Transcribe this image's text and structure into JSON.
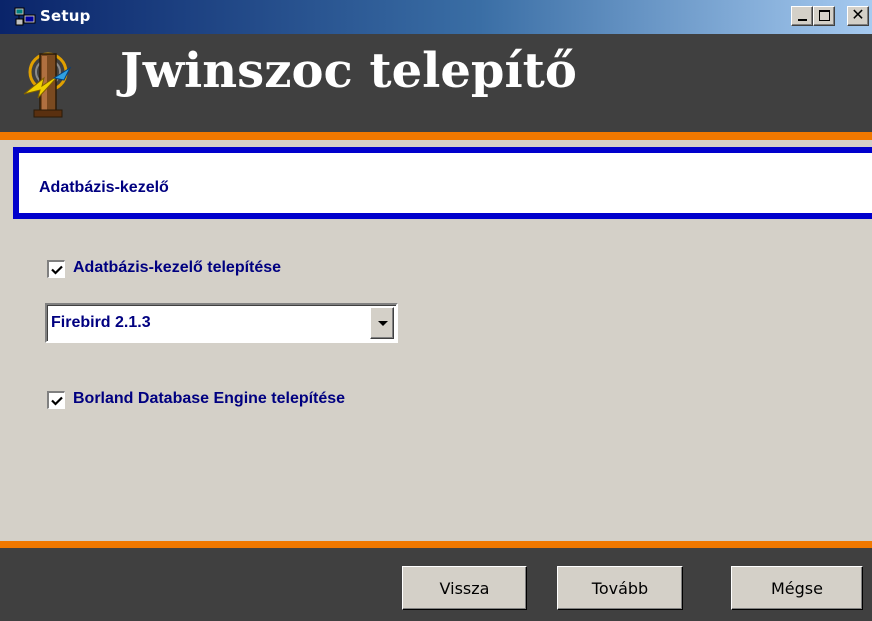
{
  "window": {
    "title": "Setup",
    "icon": "setup-computer-icon"
  },
  "header": {
    "title": "Jwinszoc telepítő",
    "logo_icon": "jwinszoc-logo-icon"
  },
  "section": {
    "title": "Adatbázis-kezelő"
  },
  "options": {
    "install_db": {
      "label": "Adatbázis-kezelő telepítése",
      "checked": true
    },
    "db_select": {
      "value": "Firebird 2.1.3"
    },
    "install_bde": {
      "label": "Borland Database Engine telepítése",
      "checked": true
    }
  },
  "buttons": {
    "back": "Vissza",
    "next": "Tovább",
    "cancel": "Mégse"
  },
  "colors": {
    "accent_orange": "#f07800",
    "header_bg": "#404040",
    "section_border": "#0000cc",
    "label_navy": "#000080"
  }
}
